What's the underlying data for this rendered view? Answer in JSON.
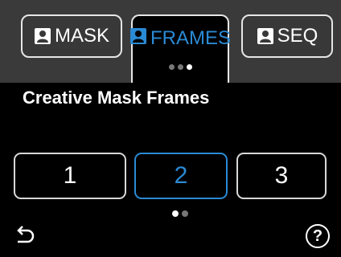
{
  "tabs": [
    {
      "label": "MASK",
      "icon": "person-icon",
      "active": false
    },
    {
      "label": "FRAMES",
      "icon": "person-icon",
      "active": true
    },
    {
      "label": "SEQ",
      "icon": "person-icon",
      "active": false
    }
  ],
  "page_indicator": {
    "count": 3,
    "active_index": 2
  },
  "screen_title": "Creative Mask Frames",
  "frames": [
    {
      "label": "1",
      "selected": false
    },
    {
      "label": "2",
      "selected": true
    },
    {
      "label": "3",
      "selected": false
    }
  ],
  "frame_pager": {
    "count": 2,
    "active_index": 0
  },
  "footer": {
    "back_icon": "back-arrow-icon",
    "help_label": "?"
  },
  "colors": {
    "accent": "#2a8ad4",
    "topbar": "#3a3a3a",
    "background": "#000000"
  }
}
